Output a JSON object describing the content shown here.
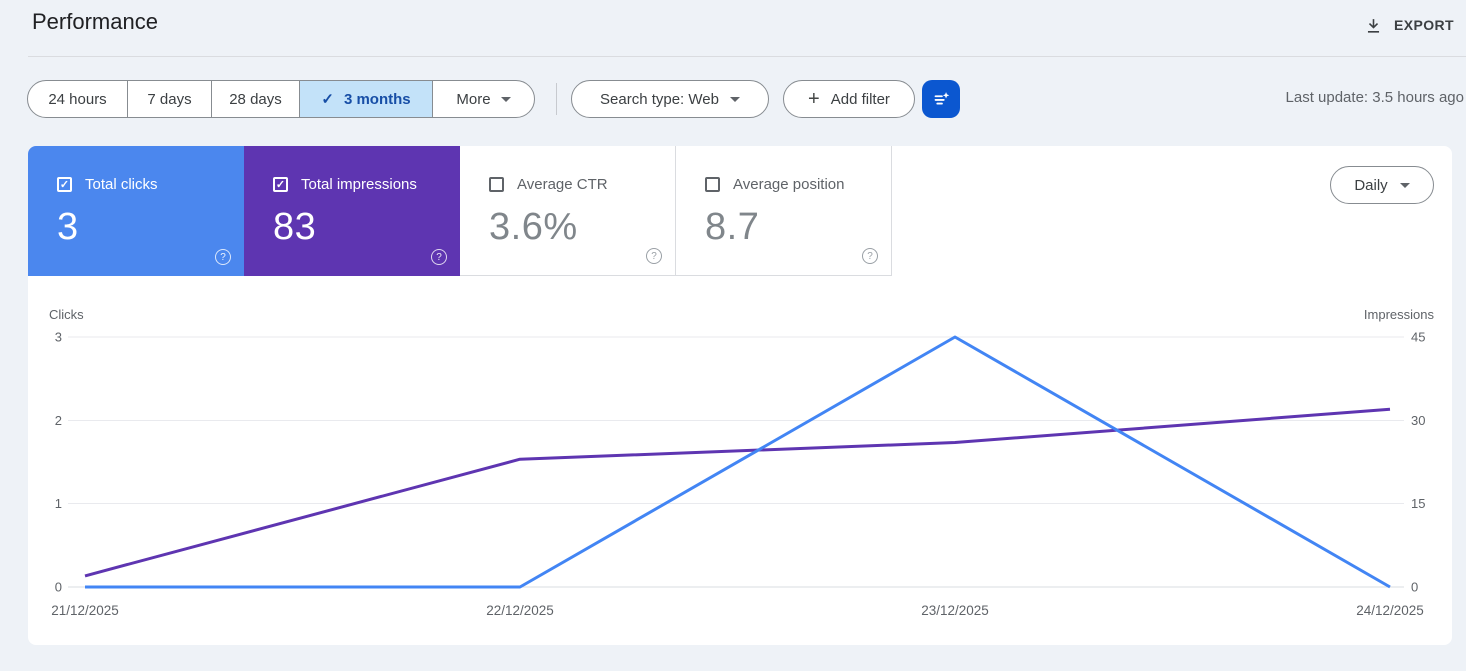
{
  "header": {
    "title": "Performance",
    "export_label": "EXPORT"
  },
  "toolbar": {
    "date_ranges": [
      {
        "label": "24 hours",
        "selected": false
      },
      {
        "label": "7 days",
        "selected": false
      },
      {
        "label": "28 days",
        "selected": false
      },
      {
        "label": "3 months",
        "selected": true
      }
    ],
    "more_label": "More",
    "search_type_label": "Search type: Web",
    "add_filter_label": "Add filter",
    "last_update": "Last update: 3.5 hours ago"
  },
  "metrics": {
    "cards": [
      {
        "label": "Total clicks",
        "value": "3",
        "checked": true,
        "color": "#4b87ee"
      },
      {
        "label": "Total impressions",
        "value": "83",
        "checked": true,
        "color": "#5e35b1"
      },
      {
        "label": "Average CTR",
        "value": "3.6%",
        "checked": false,
        "color": "#ffffff"
      },
      {
        "label": "Average position",
        "value": "8.7",
        "checked": false,
        "color": "#ffffff"
      }
    ],
    "granularity_label": "Daily"
  },
  "chart_data": {
    "type": "line",
    "x": [
      "21/12/2025",
      "22/12/2025",
      "23/12/2025",
      "24/12/2025"
    ],
    "series": [
      {
        "name": "Clicks",
        "axis": "left",
        "color": "#4285f4",
        "values": [
          0,
          0,
          3,
          0
        ]
      },
      {
        "name": "Impressions",
        "axis": "right",
        "color": "#5e35b1",
        "values": [
          2,
          23,
          26,
          32
        ]
      }
    ],
    "left_axis": {
      "label": "Clicks",
      "ticks": [
        3,
        2,
        1,
        0
      ],
      "max": 3
    },
    "right_axis": {
      "label": "Impressions",
      "ticks": [
        45,
        30,
        15,
        0
      ],
      "max": 45
    },
    "grid": true,
    "legend": "none",
    "grid_color": "#e9eaee",
    "baseline_color": "#dadce0",
    "tick_color": "#5f6368"
  },
  "icons": {
    "export": "download-icon",
    "more": "chevron-down-icon",
    "search_type": "chevron-down-icon",
    "add_filter": "plus-icon",
    "filter_button": "filter-sparkle-icon",
    "selected_range": "check-icon",
    "metric_help": "help-circle-icon",
    "daily": "chevron-down-icon"
  }
}
